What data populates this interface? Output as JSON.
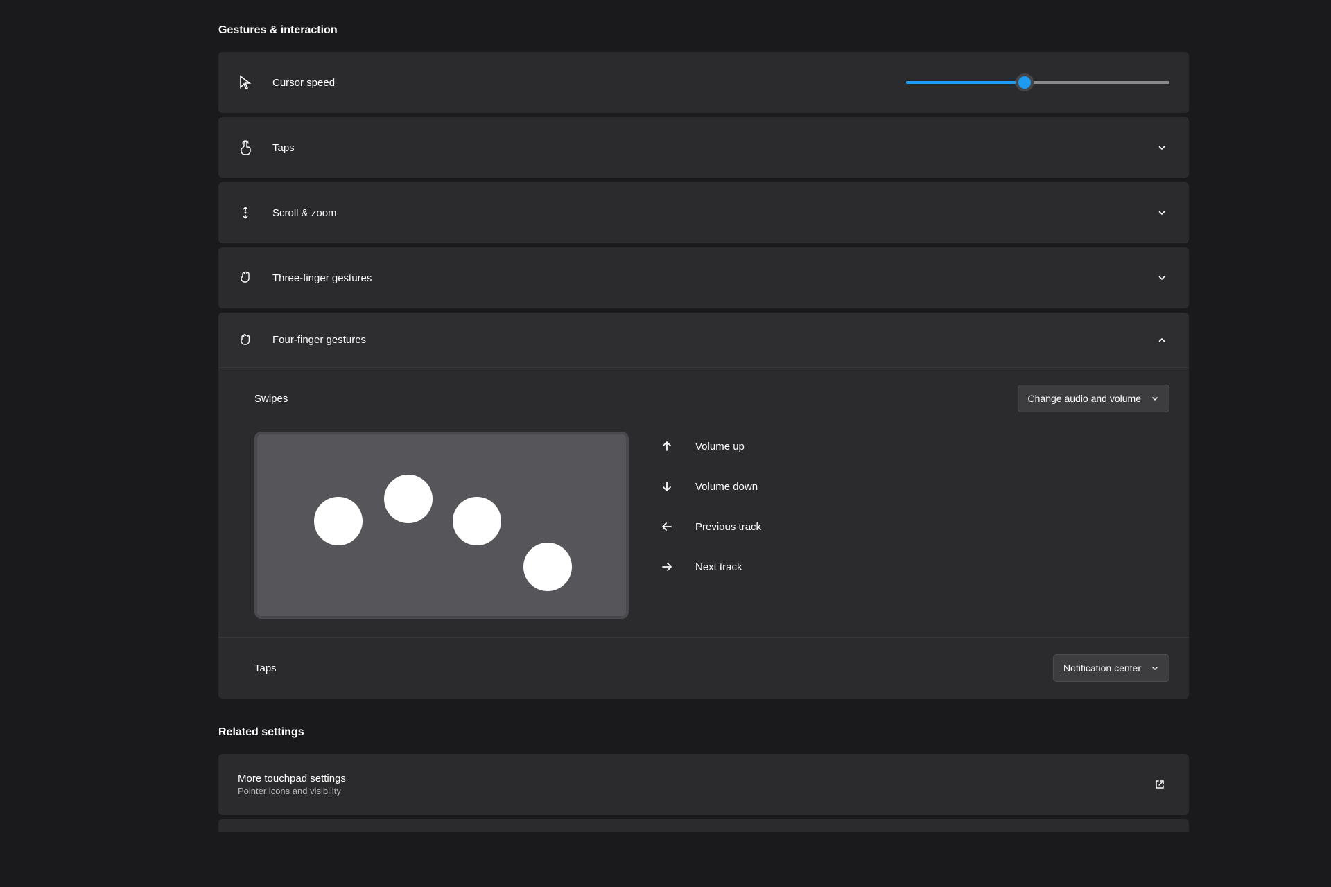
{
  "sectionHeaders": {
    "gestures": "Gestures & interaction",
    "related": "Related settings"
  },
  "cursorSpeed": {
    "label": "Cursor speed",
    "valuePercent": 45
  },
  "rows": {
    "taps": "Taps",
    "scrollZoom": "Scroll & zoom",
    "threeFinger": "Three-finger gestures",
    "fourFinger": "Four-finger gestures"
  },
  "fourFinger": {
    "swipesLabel": "Swipes",
    "swipesDropdown": "Change audio and volume",
    "gestures": {
      "up": "Volume up",
      "down": "Volume down",
      "left": "Previous track",
      "right": "Next track"
    },
    "tapsLabel": "Taps",
    "tapsDropdown": "Notification center"
  },
  "moreTouchpad": {
    "title": "More touchpad settings",
    "subtitle": "Pointer icons and visibility"
  }
}
